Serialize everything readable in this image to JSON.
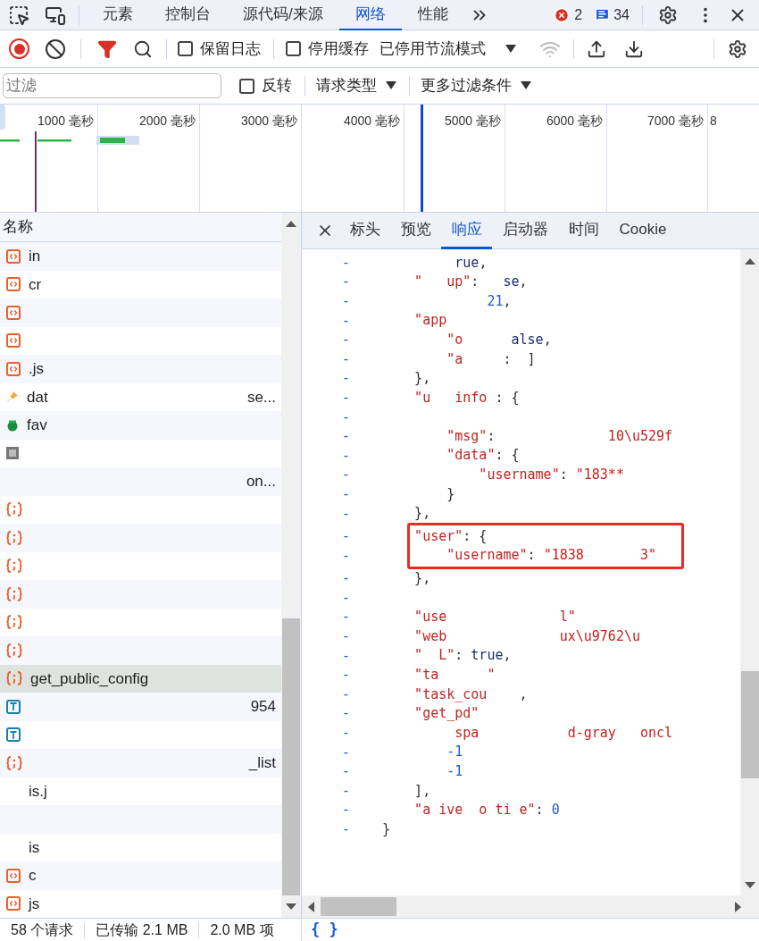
{
  "main_tabs": [
    {
      "label": "元素",
      "selected": false
    },
    {
      "label": "控制台",
      "selected": false
    },
    {
      "label": "源代码/来源",
      "selected": false
    },
    {
      "label": "网络",
      "selected": true
    },
    {
      "label": "性能",
      "selected": false
    }
  ],
  "error_count": "2",
  "message_count": "34",
  "network_toolbar": {
    "recording": true,
    "preserve_log": {
      "label": "保留日志",
      "checked": false
    },
    "disable_cache": {
      "label": "停用缓存",
      "checked": false
    },
    "throttling": "已停用节流模式"
  },
  "filter_bar": {
    "placeholder": "过滤",
    "invert": {
      "label": "反转",
      "checked": false
    },
    "request_types": "请求类型",
    "more_filters": "更多过滤条件"
  },
  "timeline": {
    "ticks": [
      "1000 毫秒",
      "2000 毫秒",
      "3000 毫秒",
      "4000 毫秒",
      "5000 毫秒",
      "6000 毫秒",
      "7000 毫秒",
      "8"
    ]
  },
  "request_list": {
    "column": "名称",
    "rows": [
      {
        "kind": "doc",
        "name": "in",
        "selected": false
      },
      {
        "kind": "doc",
        "name": "cr",
        "selected": false
      },
      {
        "kind": "doc",
        "selected": false
      },
      {
        "kind": "doc",
        "selected": false
      },
      {
        "kind": "doc",
        "name": ".js",
        "selected": false
      },
      {
        "kind": "pin",
        "name": "dat",
        "tail": "se...",
        "selected": false
      },
      {
        "kind": "fav",
        "name": "fav",
        "selected": false
      },
      {
        "kind": "img",
        "selected": false
      },
      {
        "kind": "blank",
        "tail": "on...",
        "selected": false
      },
      {
        "kind": "json",
        "selected": false
      },
      {
        "kind": "json",
        "selected": false
      },
      {
        "kind": "json",
        "selected": false
      },
      {
        "kind": "json",
        "selected": false
      },
      {
        "kind": "json",
        "selected": false
      },
      {
        "kind": "json",
        "selected": false
      },
      {
        "kind": "json",
        "name": "get_public_config",
        "selected": true
      },
      {
        "kind": "text",
        "tail": "954",
        "selected": false
      },
      {
        "kind": "text",
        "selected": false
      },
      {
        "kind": "json",
        "tail": "_list",
        "selected": false
      },
      {
        "kind": "blank",
        "name": "is.j",
        "selected": false
      },
      {
        "kind": "blank",
        "selected": false
      },
      {
        "kind": "blank",
        "name": "is",
        "selected": false
      },
      {
        "kind": "doc",
        "name": "c",
        "selected": false
      },
      {
        "kind": "doc",
        "name": "js",
        "selected": false
      }
    ]
  },
  "detail_tabs": [
    {
      "label": "标头",
      "selected": false
    },
    {
      "label": "预览",
      "selected": false
    },
    {
      "label": "响应",
      "selected": true
    },
    {
      "label": "启动器",
      "selected": false
    },
    {
      "label": "时间",
      "selected": false
    },
    {
      "label": "Cookie",
      "selected": false
    }
  ],
  "response_lines": [
    {
      "kind": "line",
      "marker": "-",
      "tokens": [
        {
          "kind": "bool",
          "text": "         rue"
        },
        {
          "kind": "punct",
          "text": ","
        }
      ]
    },
    {
      "kind": "line",
      "marker": "-",
      "tokens": [
        {
          "kind": "key",
          "text": "    \"   up\""
        },
        {
          "kind": "punct",
          "text": ":   "
        },
        {
          "kind": "bool",
          "text": "se"
        },
        {
          "kind": "punct",
          "text": ","
        }
      ]
    },
    {
      "kind": "line",
      "marker": "-",
      "tokens": [
        {
          "kind": "num",
          "text": "             21"
        },
        {
          "kind": "punct",
          "text": ","
        }
      ]
    },
    {
      "kind": "line",
      "marker": "-",
      "tokens": [
        {
          "kind": "key",
          "text": "    \"app"
        }
      ]
    },
    {
      "kind": "line",
      "marker": "-",
      "tokens": [
        {
          "kind": "key",
          "text": "        \"o"
        },
        {
          "kind": "bool",
          "text": "      alse"
        },
        {
          "kind": "punct",
          "text": ","
        }
      ]
    },
    {
      "kind": "line",
      "marker": "-",
      "tokens": [
        {
          "kind": "key",
          "text": "        \"a"
        },
        {
          "kind": "punct",
          "text": "     :  ]"
        }
      ]
    },
    {
      "kind": "line",
      "marker": "-",
      "tokens": [
        {
          "kind": "punct",
          "text": "    },"
        }
      ]
    },
    {
      "kind": "line",
      "marker": "-",
      "tokens": [
        {
          "kind": "key",
          "text": "    \"u   info"
        },
        {
          "kind": "punct",
          "text": " : {"
        }
      ]
    },
    {
      "kind": "line",
      "marker": "-"
    },
    {
      "kind": "line",
      "marker": "-",
      "tokens": [
        {
          "kind": "key",
          "text": "        \"msg\""
        },
        {
          "kind": "punct",
          "text": ":"
        },
        {
          "kind": "str",
          "text": "              10\\u529f"
        }
      ]
    },
    {
      "kind": "line",
      "marker": "-",
      "tokens": [
        {
          "kind": "key",
          "text": "        \"data\""
        },
        {
          "kind": "punct",
          "text": ": {"
        }
      ]
    },
    {
      "kind": "line",
      "marker": "-",
      "tokens": [
        {
          "kind": "key",
          "text": "            \"username\""
        },
        {
          "kind": "punct",
          "text": ": "
        },
        {
          "kind": "str",
          "text": "\"183**"
        }
      ]
    },
    {
      "kind": "line",
      "marker": "-",
      "tokens": [
        {
          "kind": "punct",
          "text": "        }"
        }
      ]
    },
    {
      "kind": "line",
      "marker": "-",
      "tokens": [
        {
          "kind": "punct",
          "text": "    },"
        }
      ]
    },
    {
      "kind": "highlight",
      "lines": [
        {
          "marker": "-",
          "tokens": [
            {
              "kind": "key",
              "text": "    \"user\""
            },
            {
              "kind": "punct",
              "text": ": {"
            }
          ]
        },
        {
          "marker": "-",
          "tokens": [
            {
              "kind": "key",
              "text": "        \"username\""
            },
            {
              "kind": "punct",
              "text": ": "
            },
            {
              "kind": "str",
              "text": "\"1838       3\""
            }
          ]
        }
      ]
    },
    {
      "kind": "line",
      "marker": "-",
      "tokens": [
        {
          "kind": "punct",
          "text": "    },"
        }
      ]
    },
    {
      "kind": "line",
      "marker": "-"
    },
    {
      "kind": "line",
      "marker": "-",
      "tokens": [
        {
          "kind": "key",
          "text": "    \"use"
        },
        {
          "kind": "str",
          "text": "              l\""
        }
      ]
    },
    {
      "kind": "line",
      "marker": "-",
      "tokens": [
        {
          "kind": "key",
          "text": "    \"web"
        },
        {
          "kind": "str",
          "text": "              ux\\u9762\\u"
        }
      ]
    },
    {
      "kind": "line",
      "marker": "-",
      "tokens": [
        {
          "kind": "key",
          "text": "    \"  L\""
        },
        {
          "kind": "punct",
          "text": ": "
        },
        {
          "kind": "bool",
          "text": "true"
        },
        {
          "kind": "punct",
          "text": ","
        }
      ]
    },
    {
      "kind": "line",
      "marker": "-",
      "tokens": [
        {
          "kind": "key",
          "text": "    \"ta      \""
        }
      ]
    },
    {
      "kind": "line",
      "marker": "-",
      "tokens": [
        {
          "kind": "key",
          "text": "    \"task_cou"
        },
        {
          "kind": "punct",
          "text": "    ,"
        }
      ]
    },
    {
      "kind": "line",
      "marker": "-",
      "tokens": [
        {
          "kind": "key",
          "text": "    \"get_pd\""
        }
      ]
    },
    {
      "kind": "line",
      "marker": "-",
      "tokens": [
        {
          "kind": "str",
          "text": "         spa           d-gray   oncl"
        }
      ]
    },
    {
      "kind": "line",
      "marker": "-",
      "tokens": [
        {
          "kind": "num",
          "text": "        -1"
        }
      ]
    },
    {
      "kind": "line",
      "marker": "-",
      "tokens": [
        {
          "kind": "num",
          "text": "        -1"
        }
      ]
    },
    {
      "kind": "line",
      "marker": "-",
      "tokens": [
        {
          "kind": "punct",
          "text": "    ],"
        }
      ]
    },
    {
      "kind": "line",
      "marker": "-",
      "tokens": [
        {
          "kind": "key",
          "text": "    \"a ive  o ti e\""
        },
        {
          "kind": "punct",
          "text": ": "
        },
        {
          "kind": "num",
          "text": "0"
        }
      ]
    },
    {
      "kind": "line",
      "marker": "-",
      "tokens": [
        {
          "kind": "punct",
          "text": "}"
        }
      ]
    }
  ],
  "status_bar": [
    "58 个请求",
    "已传输 2.1 MB",
    "2.0 MB 项"
  ],
  "format_button": "{ }"
}
